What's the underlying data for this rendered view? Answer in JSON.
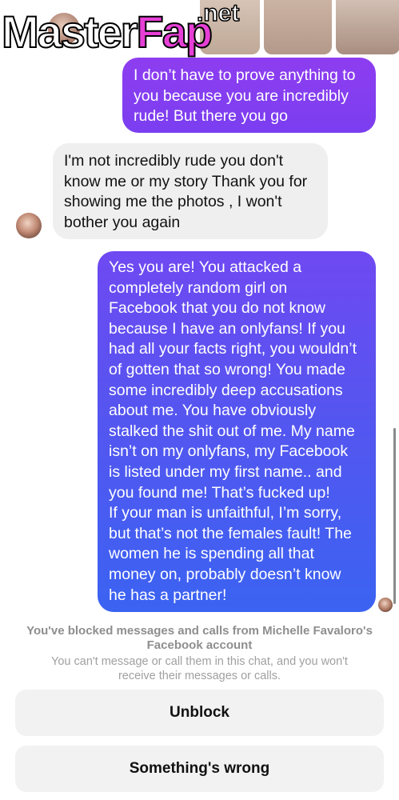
{
  "header": {
    "contact_name_partial": "Michelle Favaloro"
  },
  "watermark": {
    "part1": "Master",
    "part2": "Fap",
    "suffix": ".net"
  },
  "messages": [
    {
      "direction": "outgoing",
      "text": "I don’t have to prove anything to\nyou because you are incredibly\nrude! But there you go"
    },
    {
      "direction": "incoming",
      "text": "I'm not incredibly rude you don't\nknow me or my story Thank you for\nshowing me the photos , I won't\nbother you again"
    },
    {
      "direction": "outgoing",
      "text": "Yes you are! You attacked a\ncompletely random girl on\nFacebook that you do not know\nbecause I have an onlyfans! If you\nhad all your facts right, you wouldn’t\nof gotten that so wrong! You made\nsome incredibly deep accusations\nabout me. You have obviously\nstalked the shit out of me. My name\nisn’t on my onlyfans, my Facebook\nis listed under my first name.. and\nyou found me! That’s fucked up!\nIf your man is unfaithful, I’m sorry,\nbut that’s not the females fault! The\nwomen he is spending all that\nmoney on, probably doesn’t know\nhe has a partner!"
    }
  ],
  "blocked": {
    "title": "You've blocked messages and calls from Michelle Favaloro's\nFacebook account",
    "subtitle": "You can't message or call them in this chat, and you won't\nreceive their messages or calls."
  },
  "actions": {
    "unblock_label": "Unblock",
    "wrong_label": "Something's wrong"
  },
  "colors": {
    "outgoing_top": "#8e3df0",
    "outgoing_bottom": "#3b63f2",
    "incoming": "#efefef",
    "button_bg": "#f2f2f2"
  }
}
